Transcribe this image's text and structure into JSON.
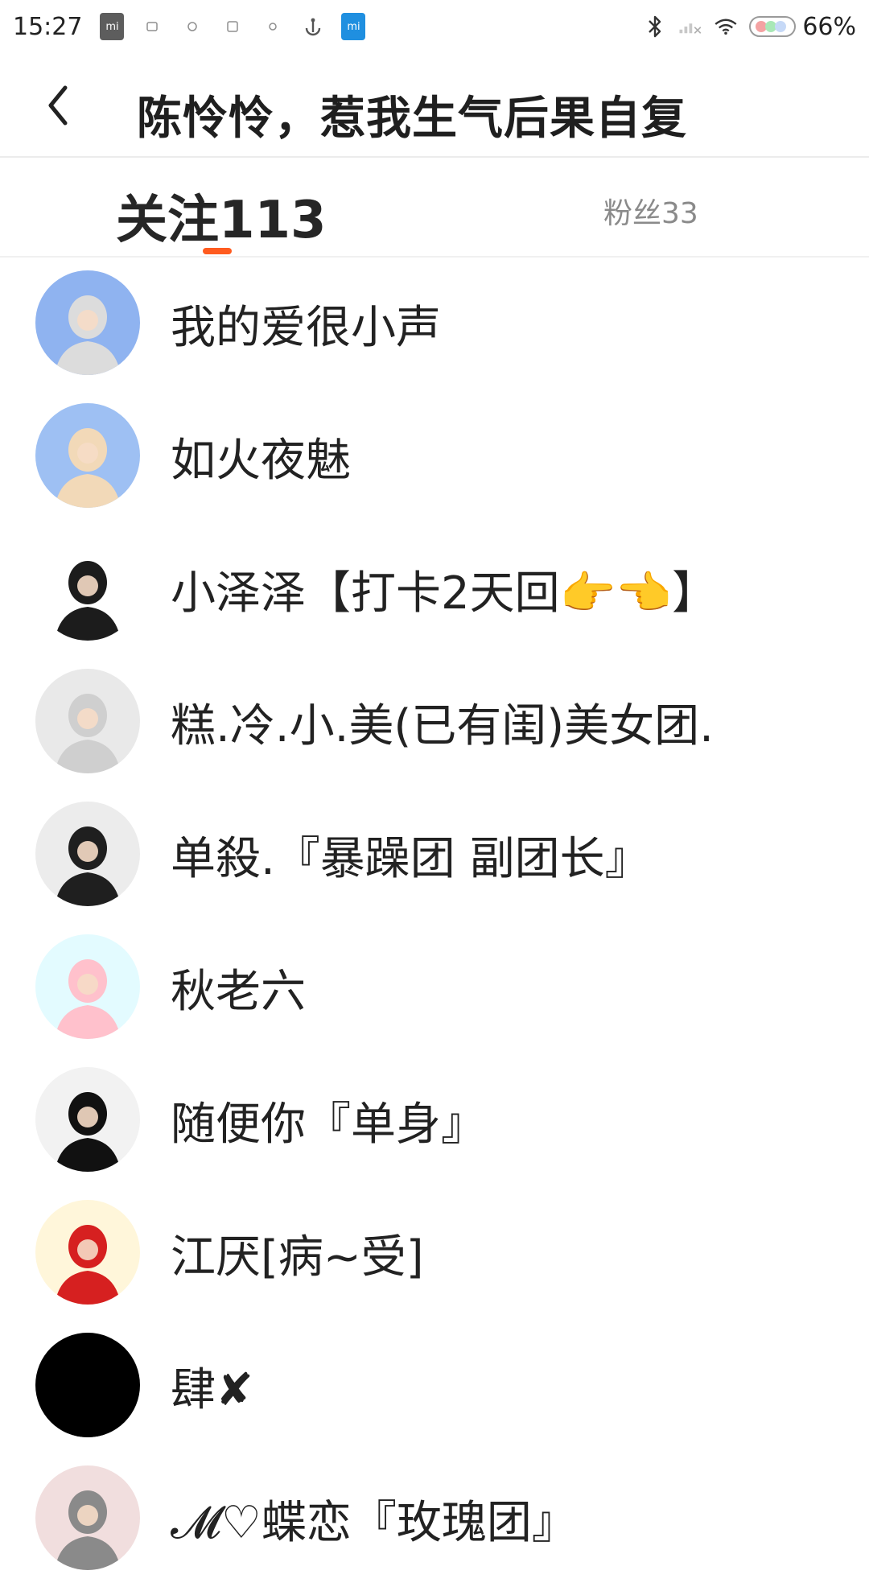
{
  "status_bar": {
    "time": "15:27",
    "battery": "66%",
    "app_icons": [
      "mi-icon",
      "notification-icon",
      "notification-icon",
      "notification-icon",
      "notification-icon",
      "anchor-icon",
      "mi-icon"
    ],
    "right_icons": [
      "bluetooth-icon",
      "signal-icon",
      "wifi-icon",
      "battery-icon"
    ]
  },
  "header": {
    "title": "陈怜怜，惹我生气后果自复"
  },
  "tabs": {
    "follow_label": "关注113",
    "fans_label": "粉丝33",
    "accent_color": "#ff5b1f"
  },
  "users": [
    {
      "name": "我的爱很小声",
      "avatar_bg": "#8fb3f0",
      "avatar_fg": "#dcdcdc"
    },
    {
      "name": "如火夜魅",
      "avatar_bg": "#9ec0f3",
      "avatar_fg": "#f2d9b8"
    },
    {
      "name": "小泽泽【打卡2天回👉👈】",
      "avatar_bg": "#ffffff",
      "avatar_fg": "#1c1c1c"
    },
    {
      "name": "糕.冷.小.美(已有闺)美女团.",
      "avatar_bg": "#e9e9e9",
      "avatar_fg": "#cfcfcf"
    },
    {
      "name": "单殺.『暴躁团  副团长』",
      "avatar_bg": "#ececec",
      "avatar_fg": "#1f1f1f"
    },
    {
      "name": "秋老六",
      "avatar_bg": "#e3fbff",
      "avatar_fg": "#ffc1cc"
    },
    {
      "name": "随便你『单身』",
      "avatar_bg": "#f2f2f2",
      "avatar_fg": "#111111"
    },
    {
      "name": "江厌[病~受]",
      "avatar_bg": "#fff6da",
      "avatar_fg": "#d62020"
    },
    {
      "name": "肆✘",
      "avatar_bg": "#000000",
      "avatar_fg": "#000000"
    },
    {
      "name": "𝓜♡蝶恋『玫瑰团』",
      "avatar_bg": "#f1dede",
      "avatar_fg": "#8a8a8a"
    }
  ]
}
